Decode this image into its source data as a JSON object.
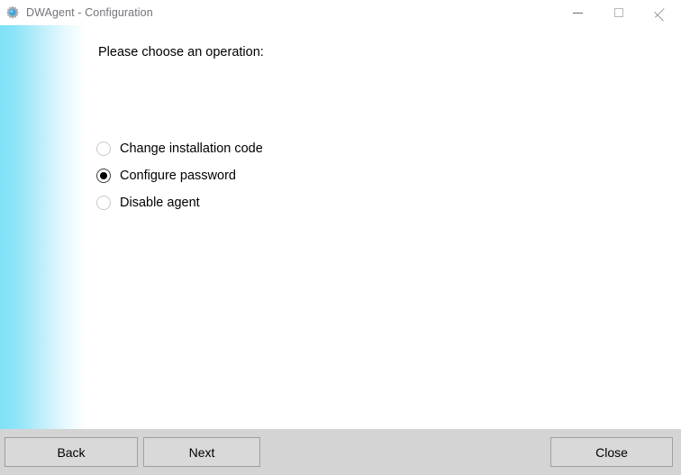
{
  "window": {
    "title": "DWAgent - Configuration",
    "icon": "gear-icon",
    "controls": {
      "minimize": "minimize-icon",
      "maximize": "maximize-icon",
      "close": "close-icon"
    }
  },
  "colors": {
    "accent_gradient_start": "#7fe1f7",
    "accent_gradient_end": "#ffffff",
    "bottom_bar": "#d4d4d4",
    "button_face": "#d9d9d9",
    "button_border": "#9f9f9f",
    "title_text": "#72747a",
    "body_text": "#000000"
  },
  "main": {
    "prompt": "Please choose an operation:",
    "options": [
      {
        "label": "Change installation code",
        "selected": false
      },
      {
        "label": "Configure password",
        "selected": true
      },
      {
        "label": "Disable agent",
        "selected": false
      }
    ],
    "selected_option": "Configure password"
  },
  "footer": {
    "back_label": "Back",
    "next_label": "Next",
    "close_label": "Close"
  }
}
